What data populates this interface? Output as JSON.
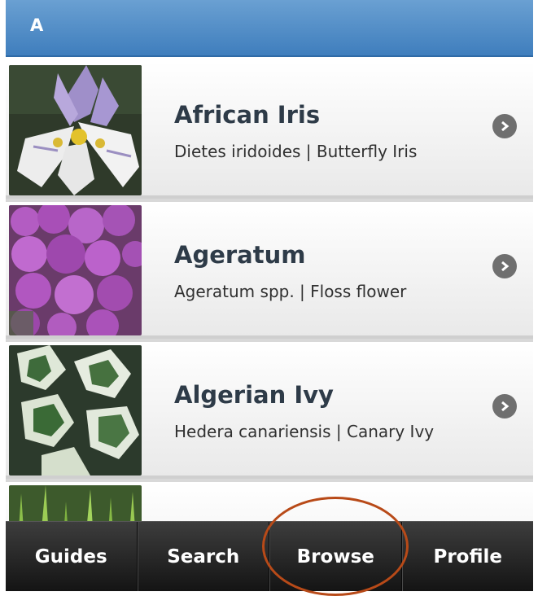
{
  "header": {
    "letter": "A"
  },
  "plants": [
    {
      "name": "African Iris",
      "subtitle": "Dietes iridoides | Butterfly Iris",
      "thumb_icon": "iris-flower-photo"
    },
    {
      "name": "Ageratum",
      "subtitle": "Ageratum spp. | Floss flower",
      "thumb_icon": "ageratum-flower-photo"
    },
    {
      "name": "Algerian Ivy",
      "subtitle": "Hedera canariensis | Canary Ivy",
      "thumb_icon": "ivy-leaf-photo"
    },
    {
      "name": "",
      "subtitle": "",
      "thumb_icon": "grass-photo"
    }
  ],
  "tabs": [
    {
      "label": "Guides"
    },
    {
      "label": "Search"
    },
    {
      "label": "Browse"
    },
    {
      "label": "Profile"
    }
  ],
  "colors": {
    "header_blue": "#4a86c5",
    "title_text": "#2e3b48",
    "tab_bar": "#2a2a2a",
    "highlight_circle": "#b84a18"
  }
}
